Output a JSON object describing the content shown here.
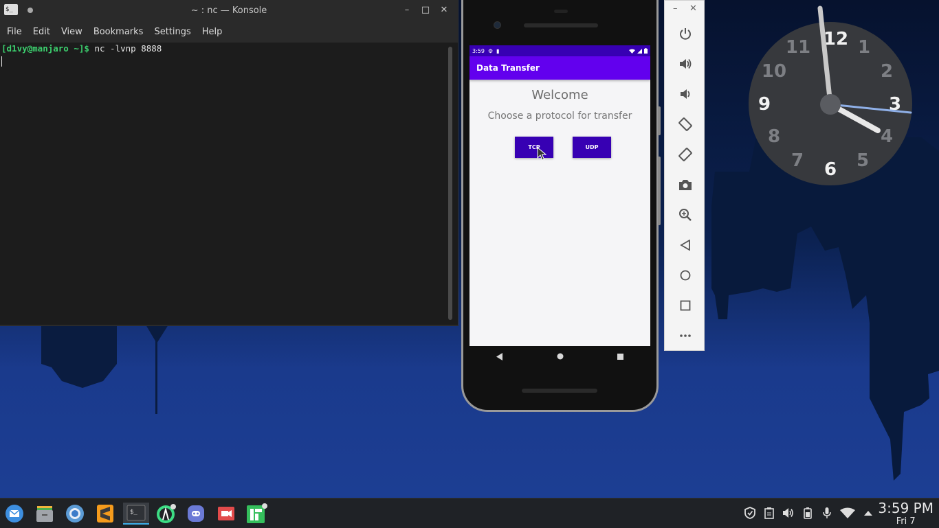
{
  "konsole": {
    "title": "~ : nc — Konsole",
    "app_icon_glyph": "$_",
    "window_buttons": {
      "minimize": "–",
      "maximize": "□",
      "close": "✕"
    },
    "menu": [
      "File",
      "Edit",
      "View",
      "Bookmarks",
      "Settings",
      "Help"
    ],
    "prompt": "[d1vy@manjaro ~]$",
    "command": "nc -lvnp 8888"
  },
  "phone": {
    "status_time": "3:59",
    "app_title": "Data Transfer",
    "welcome": "Welcome",
    "subtitle": "Choose a protocol for transfer",
    "buttons": [
      "TCP",
      "UDP"
    ],
    "nav": {
      "back": "◀",
      "home": "●",
      "recents": "■"
    },
    "accent": "#6200ee",
    "accent_dark": "#3700b3"
  },
  "emulator_toolbar": {
    "window_buttons": {
      "minimize": "–",
      "close": "✕"
    },
    "buttons": [
      "power-icon",
      "volume-up-icon",
      "volume-down-icon",
      "rotate-left-icon",
      "rotate-right-icon",
      "camera-icon",
      "zoom-icon",
      "back-icon",
      "home-icon",
      "overview-icon",
      "more-icon"
    ]
  },
  "clock": {
    "numerals": [
      "12",
      "1",
      "2",
      "3",
      "4",
      "5",
      "6",
      "7",
      "8",
      "9",
      "10",
      "11"
    ],
    "time": "3:59"
  },
  "taskbar": {
    "apps": [
      "mail-icon",
      "files-icon",
      "chromium-icon",
      "sublime-icon",
      "terminal-icon",
      "android-studio-icon",
      "discord-icon",
      "screen-recorder-icon",
      "manjaro-icon"
    ],
    "tray": [
      "shield-icon",
      "clipboard-icon",
      "volume-icon",
      "battery-icon",
      "microphone-icon",
      "wifi-icon",
      "tray-expand-icon"
    ],
    "time": "3:59 PM",
    "date": "Fri 7"
  }
}
